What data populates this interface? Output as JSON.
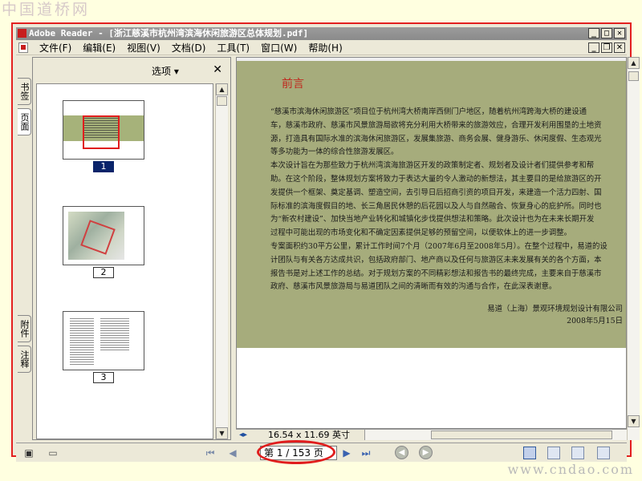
{
  "site": {
    "logo": "中国道桥网",
    "url": "www.cndao.com"
  },
  "window": {
    "title": "Adobe Reader - [浙江慈溪市杭州湾滨海休闲旅游区总体规划.pdf]",
    "buttons": {
      "minimize": "_",
      "maximize": "□",
      "close": "✕"
    }
  },
  "menu": {
    "items": [
      "文件(F)",
      "编辑(E)",
      "视图(V)",
      "文档(D)",
      "工具(T)",
      "窗口(W)",
      "帮助(H)"
    ],
    "buttons": {
      "minimize": "_",
      "restore": "❐",
      "close": "✕"
    }
  },
  "left_tabs": {
    "top": [
      "书签",
      "页面"
    ],
    "bottom": [
      "附件",
      "注释"
    ]
  },
  "panel": {
    "options_label": "选项 ▾",
    "close_label": "✕",
    "thumbnails": [
      "1",
      "2",
      "3"
    ]
  },
  "document": {
    "heading": "前言",
    "paragraphs": [
      "“慈溪市滨海休闲旅游区”项目位于杭州湾大桥南岸西侧门户地区，随着杭州湾跨海大桥的建设通",
      "车，慈溪市政府、慈溪市风景旅游局欲将充分利用大桥带来的旅游效应，合理开发利用围垦的土地资",
      "源，打造具有国际水准的滨海休闲旅游区，发展集旅游、商务会展、健身游乐、休闲度假、生态观光",
      "等多功能为一体的综合性旅游发展区。",
      "本次设计旨在为那些致力于杭州湾滨海旅游区开发的政策制定者、规划者及设计者们提供参考和帮",
      "助。在这个阶段，整体规划方案将致力于表达大量的令人激动的新想法，其主要目的是给旅游区的开",
      "发提供一个框架、奠定基调、塑造空间，去引导日后招商引资的项目开发，来建造一个活力四射、国",
      "际标准的滨海度假目的地、长三角居民休憩的后花园以及人与自然融合、恢复身心的庇护所。同时也",
      "为“新农村建设”、加快当地产业转化和城镇化步伐提供想法和策略。此次设计也为在未来长期开发",
      "过程中可能出现的市场变化和不确定因素提供足够的预留空间，以便软体上的进一步调整。",
      "专案面积约30平方公里，累计工作时间7个月（2007年6月至2008年5月）。在整个过程中，易道的设",
      "计团队与有关各方达成共识，包括政府部门、地产商以及任何与旅游区未来发展有关的各个方面，本",
      "报告书是对上述工作的总结。对于规划方案的不同精彩想法和报告书的最终完成，主要来自于慈溪市",
      "政府、慈溪市风景旅游局与易道团队之间的清晰而有效的沟通与合作，在此深表谢意。"
    ],
    "signature_company": "易道（上海）景观环境规划设计有限公司",
    "signature_date": "2008年5月15日"
  },
  "statusbar": {
    "page_size": "16.54 x 11.69 英寸",
    "page_indicator": "第 1 / 153 页"
  },
  "colors": {
    "annotation": "#e01d1d",
    "page_background": "#a6ac7c",
    "heading": "#c0281e",
    "selection": "#0a246a"
  }
}
